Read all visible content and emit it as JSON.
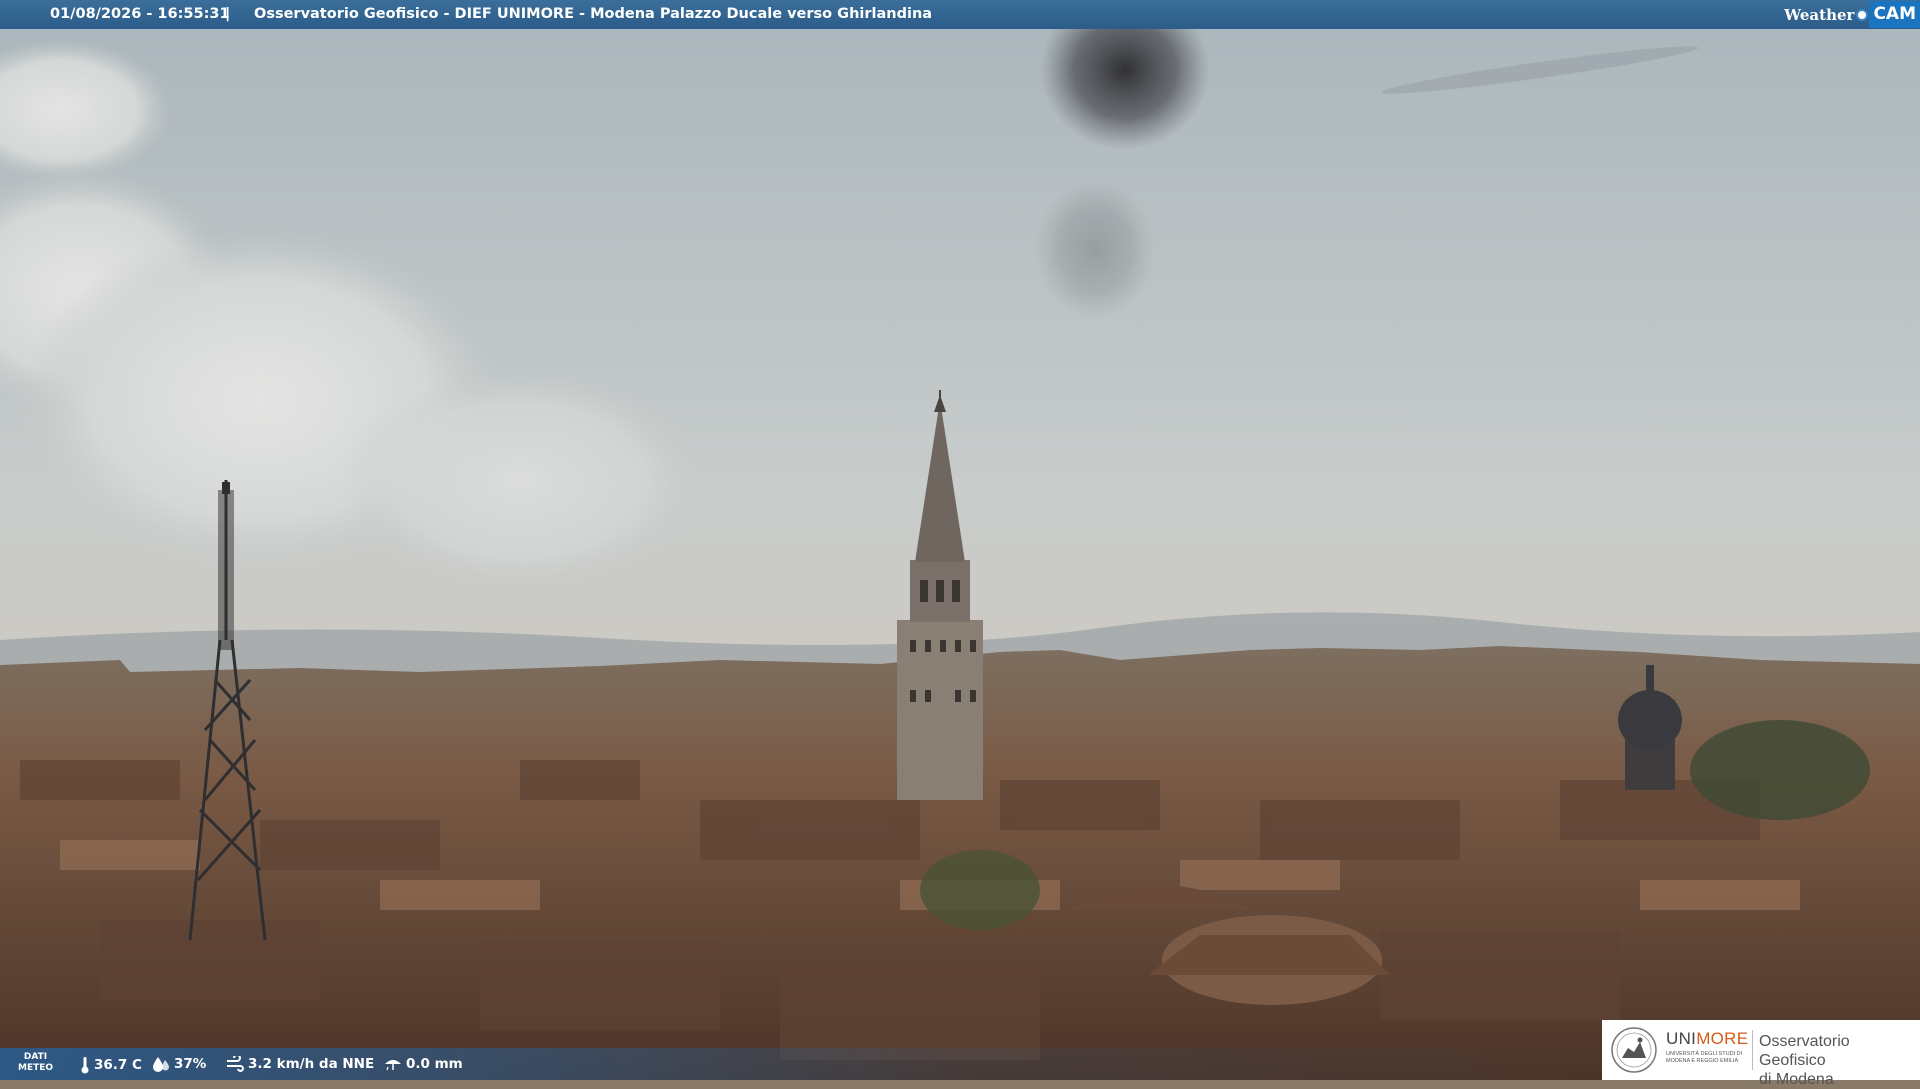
{
  "header": {
    "datetime": "01/08/2026 - 16:55:31",
    "separator": "|",
    "caption": "Osservatorio Geofisico - DIEF UNIMORE - Modena Palazzo Ducale verso Ghirlandina",
    "brand_weather": "Weather",
    "brand_cam": "CAM"
  },
  "meteo": {
    "label_line1": "DATI",
    "label_line2": "METEO",
    "temperature": "36.7 C",
    "humidity": "37%",
    "wind": "3.2 km/h da NNE",
    "rain": "0.0 mm",
    "icons": [
      "thermometer-icon",
      "humidity-drop-icon",
      "wind-icon",
      "rain-icon"
    ]
  },
  "logo": {
    "unimore_prefix": "UNI",
    "unimore_suffix": "MORE",
    "university_subtitle": "UNIVERSITÀ DEGLI STUDI DI MODENA E REGGIO EMILIA",
    "title_line1": "Osservatorio Geofisico",
    "title_line2": "di Modena"
  },
  "colors": {
    "bar_blue": "#2c5d8a",
    "brand_blue": "#1a74c0",
    "unimore_orange": "#d45a17"
  }
}
